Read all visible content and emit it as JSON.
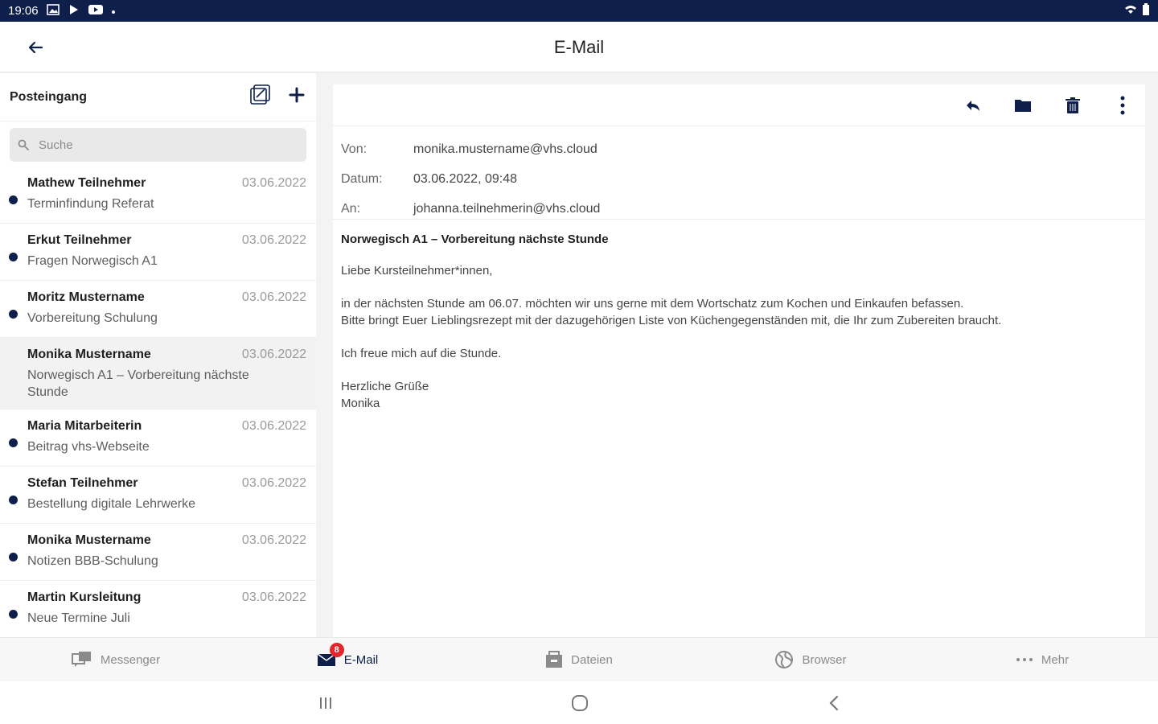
{
  "status_bar": {
    "time": "19:06"
  },
  "header": {
    "title": "E-Mail"
  },
  "sidebar": {
    "folder": "Posteingang",
    "search_placeholder": "Suche",
    "items": [
      {
        "sender": "Mathew Teilnehmer",
        "subject": "Terminfindung Referat",
        "date": "03.06.2022",
        "unread": true
      },
      {
        "sender": "Erkut Teilnehmer",
        "subject": "Fragen Norwegisch A1",
        "date": "03.06.2022",
        "unread": true
      },
      {
        "sender": "Moritz Mustername",
        "subject": "Vorbereitung Schulung",
        "date": "03.06.2022",
        "unread": true
      },
      {
        "sender": "Monika Mustername",
        "subject": "Norwegisch A1 – Vorbereitung nächste Stunde",
        "date": "03.06.2022",
        "unread": false,
        "selected": true
      },
      {
        "sender": "Maria Mitarbeiterin",
        "subject": "Beitrag vhs-Webseite",
        "date": "03.06.2022",
        "unread": true
      },
      {
        "sender": "Stefan Teilnehmer",
        "subject": "Bestellung digitale Lehrwerke",
        "date": "03.06.2022",
        "unread": true
      },
      {
        "sender": "Monika Mustername",
        "subject": "Notizen BBB-Schulung",
        "date": "03.06.2022",
        "unread": true
      },
      {
        "sender": "Martin Kursleitung",
        "subject": "Neue Termine Juli",
        "date": "03.06.2022",
        "unread": true
      }
    ]
  },
  "message": {
    "from_label": "Von:",
    "from": "monika.mustername@vhs.cloud",
    "date_label": "Datum:",
    "date": "03.06.2022, 09:48",
    "to_label": "An:",
    "to": "johanna.teilnehmerin@vhs.cloud",
    "subject": "Norwegisch A1 – Vorbereitung nächste Stunde",
    "greeting": "Liebe Kursteilnehmer*innen,",
    "line1": "in der nächsten Stunde am 06.07. möchten wir uns gerne mit dem Wortschatz zum Kochen und Einkaufen befassen.",
    "line2": "Bitte bringt Euer Lieblingsrezept mit der dazugehörigen Liste von Küchengegenständen mit, die Ihr zum Zubereiten braucht.",
    "line3": "Ich freue mich auf die Stunde.",
    "closing": "Herzliche Grüße",
    "signature": "Monika"
  },
  "bottom_nav": {
    "items": [
      {
        "label": "Messenger",
        "icon": "messenger-icon"
      },
      {
        "label": "E-Mail",
        "icon": "mail-icon",
        "badge": "8",
        "active": true
      },
      {
        "label": "Dateien",
        "icon": "files-icon"
      },
      {
        "label": "Browser",
        "icon": "browser-icon"
      },
      {
        "label": "Mehr",
        "icon": "more-icon"
      }
    ]
  },
  "colors": {
    "brand": "#0e1f4c",
    "badge": "#e3262b"
  }
}
